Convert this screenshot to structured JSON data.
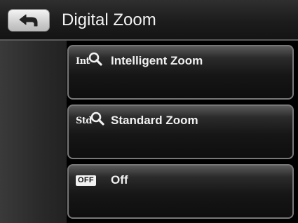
{
  "header": {
    "title": "Digital Zoom",
    "back_icon": "back-arrow-icon"
  },
  "menu": {
    "items": [
      {
        "label": "Intelligent Zoom",
        "icon_text": "Int",
        "icon": "intelligent-zoom-icon"
      },
      {
        "label": "Standard Zoom",
        "icon_text": "Std",
        "icon": "standard-zoom-icon"
      },
      {
        "label": "Off",
        "icon_text": "OFF",
        "icon": "off-icon"
      }
    ]
  }
}
